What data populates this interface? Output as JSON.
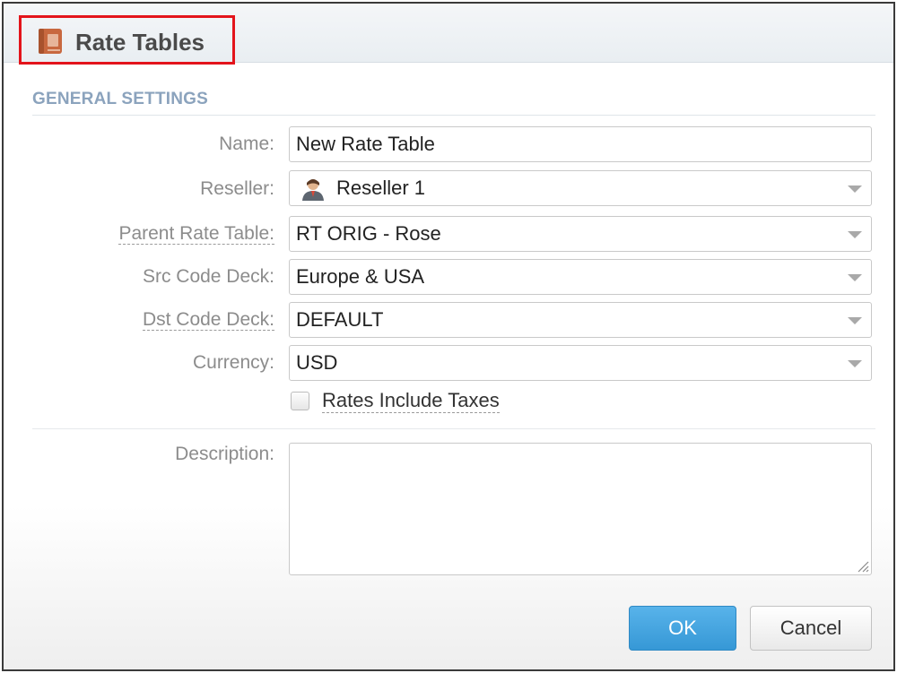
{
  "window": {
    "title": "Rate Tables",
    "icon": "book-icon"
  },
  "section": {
    "title": "GENERAL SETTINGS"
  },
  "form": {
    "name": {
      "label": "Name:",
      "value": "New Rate Table"
    },
    "reseller": {
      "label": "Reseller:",
      "value": "Reseller 1",
      "icon": "reseller-avatar-icon"
    },
    "parent_rate_table": {
      "label": "Parent Rate Table:",
      "value": "RT ORIG - Rose"
    },
    "src_code_deck": {
      "label": "Src Code Deck:",
      "value": "Europe & USA"
    },
    "dst_code_deck": {
      "label": "Dst Code Deck:",
      "value": "DEFAULT"
    },
    "currency": {
      "label": "Currency:",
      "value": "USD"
    },
    "rates_include_taxes": {
      "label": "Rates Include Taxes",
      "checked": false
    },
    "description": {
      "label": "Description:",
      "value": ""
    }
  },
  "buttons": {
    "ok_label": "OK",
    "cancel_label": "Cancel"
  },
  "colors": {
    "highlight_border": "#e3141b",
    "section_title": "#8ba3bd",
    "ok_button": "#3698d6"
  }
}
